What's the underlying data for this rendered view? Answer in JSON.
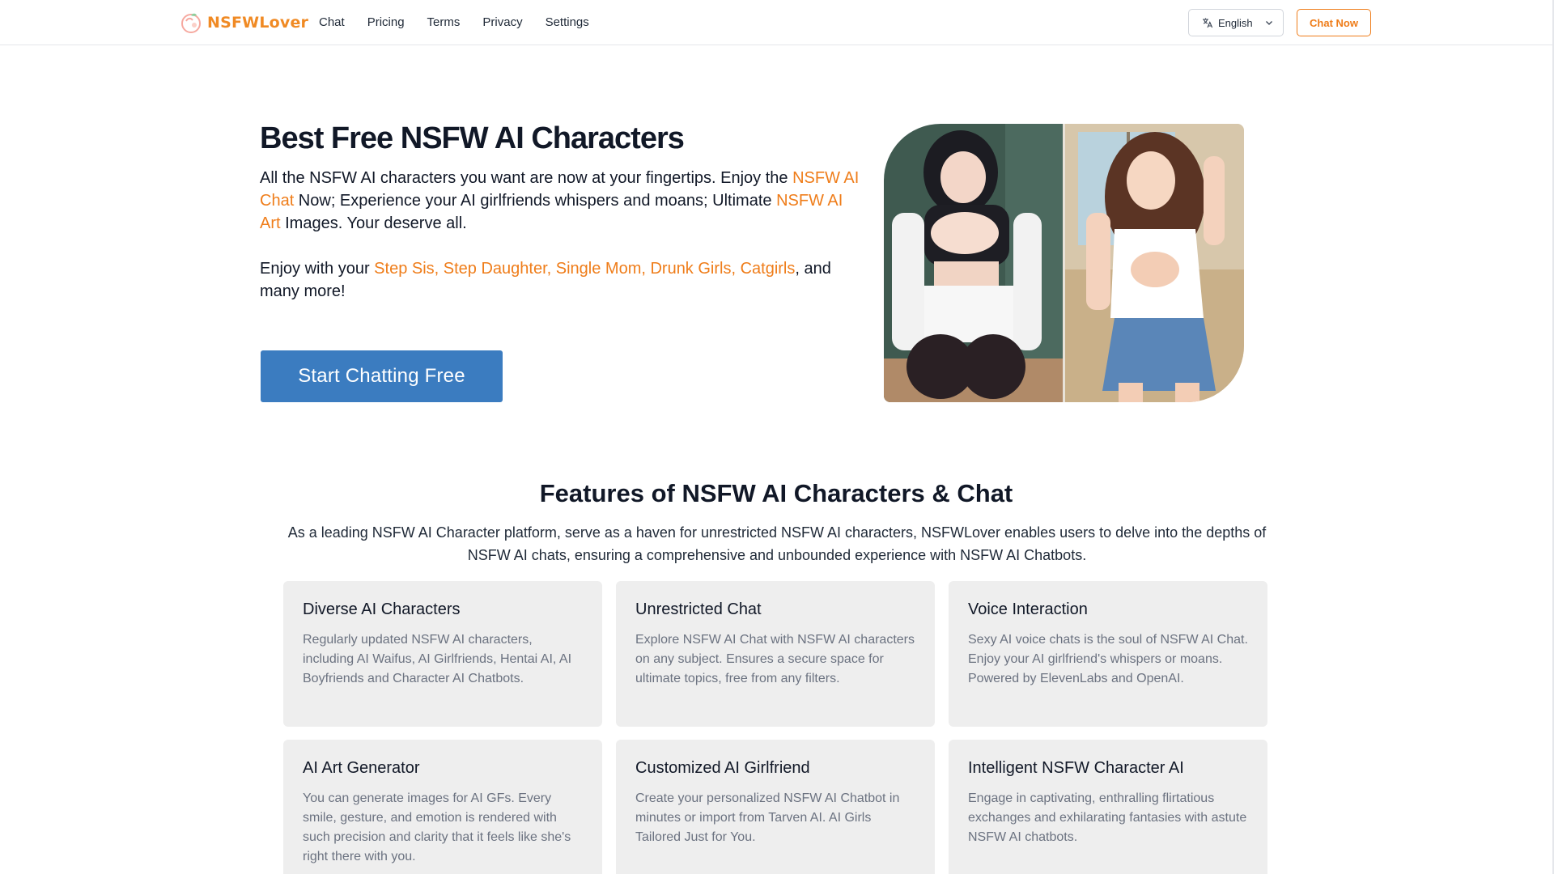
{
  "header": {
    "logo_text": "NSFWLover",
    "nav": [
      "Chat",
      "Pricing",
      "Terms",
      "Privacy",
      "Settings"
    ],
    "language": "English",
    "chat_now": "Chat Now"
  },
  "hero": {
    "title": "Best Free NSFW AI Characters",
    "p1_a": "All the NSFW AI characters you want are now at your fingertips. Enjoy the ",
    "p1_link1": "NSFW AI Chat",
    "p1_b": " Now; Experience your AI girlfriends whispers and moans; Ultimate ",
    "p1_link2": "NSFW AI Art",
    "p1_c": " Images. Your deserve all.",
    "p2_a": "Enjoy with your ",
    "p2_link": "Step Sis, Step Daughter, Single Mom, Drunk Girls, Catgirls",
    "p2_b": ", and many more!",
    "cta": "Start Chatting Free"
  },
  "features": {
    "title": "Features of NSFW AI Characters & Chat",
    "subtitle": "As a leading NSFW AI Character platform, serve as a haven for unrestricted NSFW AI characters, NSFWLover enables users to delve into the depths of NSFW AI chats, ensuring a comprehensive and unbounded experience with NSFW AI Chatbots.",
    "cards": [
      {
        "title": "Diverse AI Characters",
        "text": "Regularly updated NSFW AI characters, including AI Waifus, AI Girlfriends, Hentai AI, AI Boyfriends and Character AI Chatbots."
      },
      {
        "title": "Unrestricted Chat",
        "text": "Explore NSFW AI Chat with NSFW AI characters on any subject. Ensures a secure space for ultimate topics, free from any filters."
      },
      {
        "title": "Voice Interaction",
        "text": "Sexy AI voice chats is the soul of NSFW AI Chat. Enjoy your AI girlfriend's whispers or moans. Powered by ElevenLabs and OpenAI."
      },
      {
        "title": "AI Art Generator",
        "text": "You can generate images for AI GFs. Every smile, gesture, and emotion is rendered with such precision and clarity that it feels like she's right there with you."
      },
      {
        "title": "Customized AI Girlfriend",
        "text": "Create your personalized NSFW AI Chatbot in minutes or import from Tarven AI. AI Girls Tailored Just for You."
      },
      {
        "title": "Intelligent NSFW Character AI",
        "text": "Engage in captivating, enthralling flirtatious exchanges and exhilarating fantasies with astute NSFW AI chatbots."
      }
    ]
  },
  "colors": {
    "brand_orange": "#ef7d1a",
    "cta_blue": "#3b7cc0",
    "card_bg": "#eeeeee"
  },
  "icons": {
    "logo": "peach-logo-icon",
    "language": "translate-icon",
    "dropdown": "chevron-down-icon"
  }
}
